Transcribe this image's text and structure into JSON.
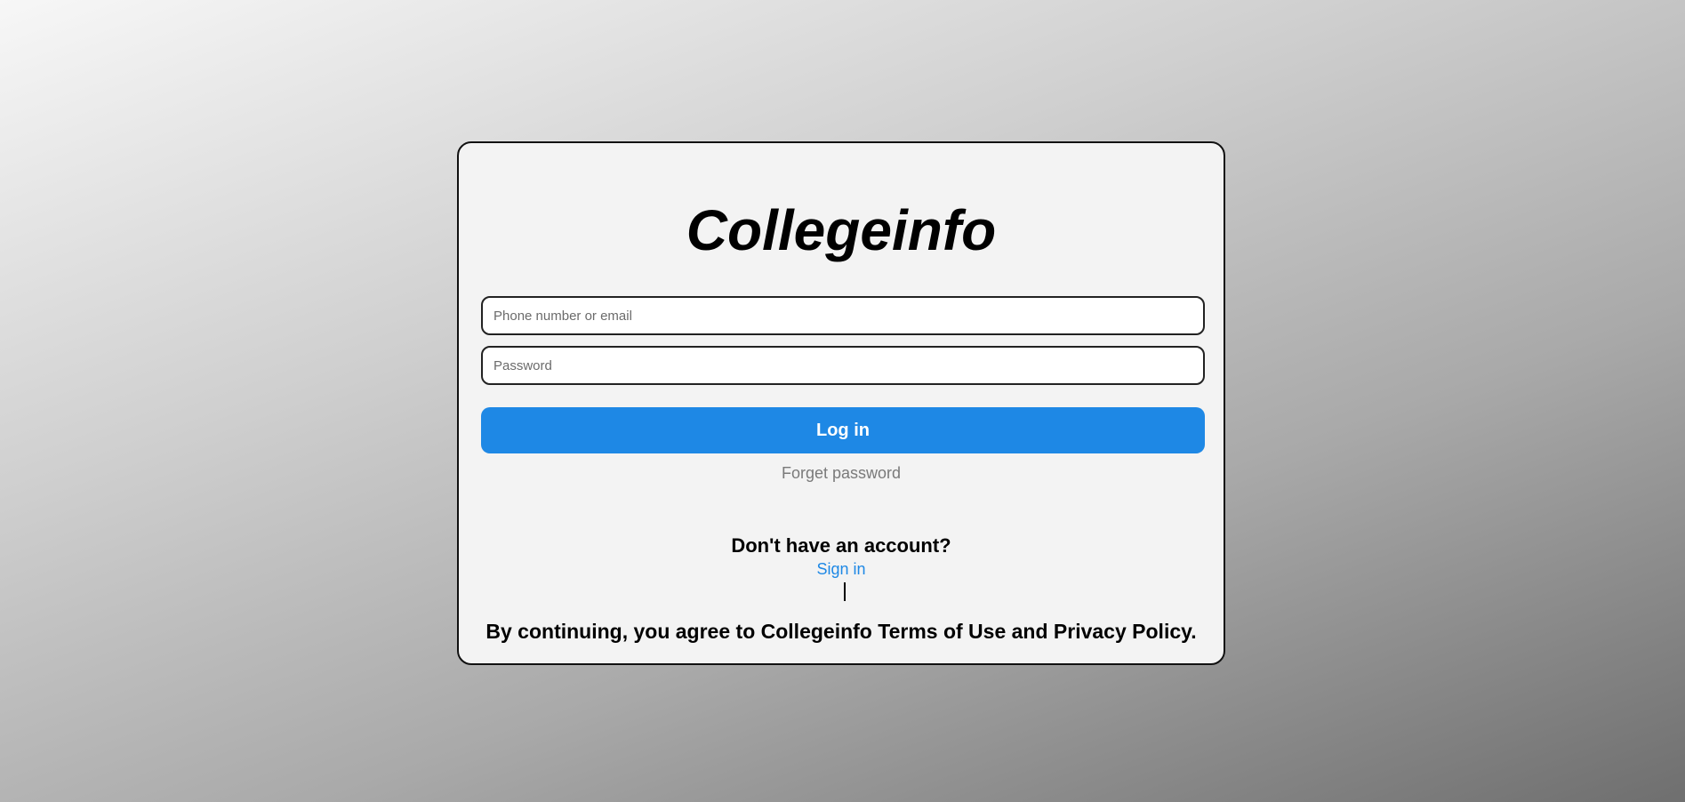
{
  "app": {
    "title": "Collegeinfo"
  },
  "form": {
    "phone_placeholder": "Phone number or email",
    "phone_value": "",
    "password_placeholder": "Password",
    "password_value": "",
    "login_label": "Log in",
    "forget_label": "Forget password"
  },
  "signup": {
    "prompt": "Don't have an account?",
    "link_label": "Sign in"
  },
  "footer": {
    "terms": "By continuing, you agree to Collegeinfo Terms of Use and Privacy Policy."
  },
  "colors": {
    "accent": "#1e88e5",
    "card_background": "#f3f3f3",
    "muted_text": "#7a7a7a"
  }
}
